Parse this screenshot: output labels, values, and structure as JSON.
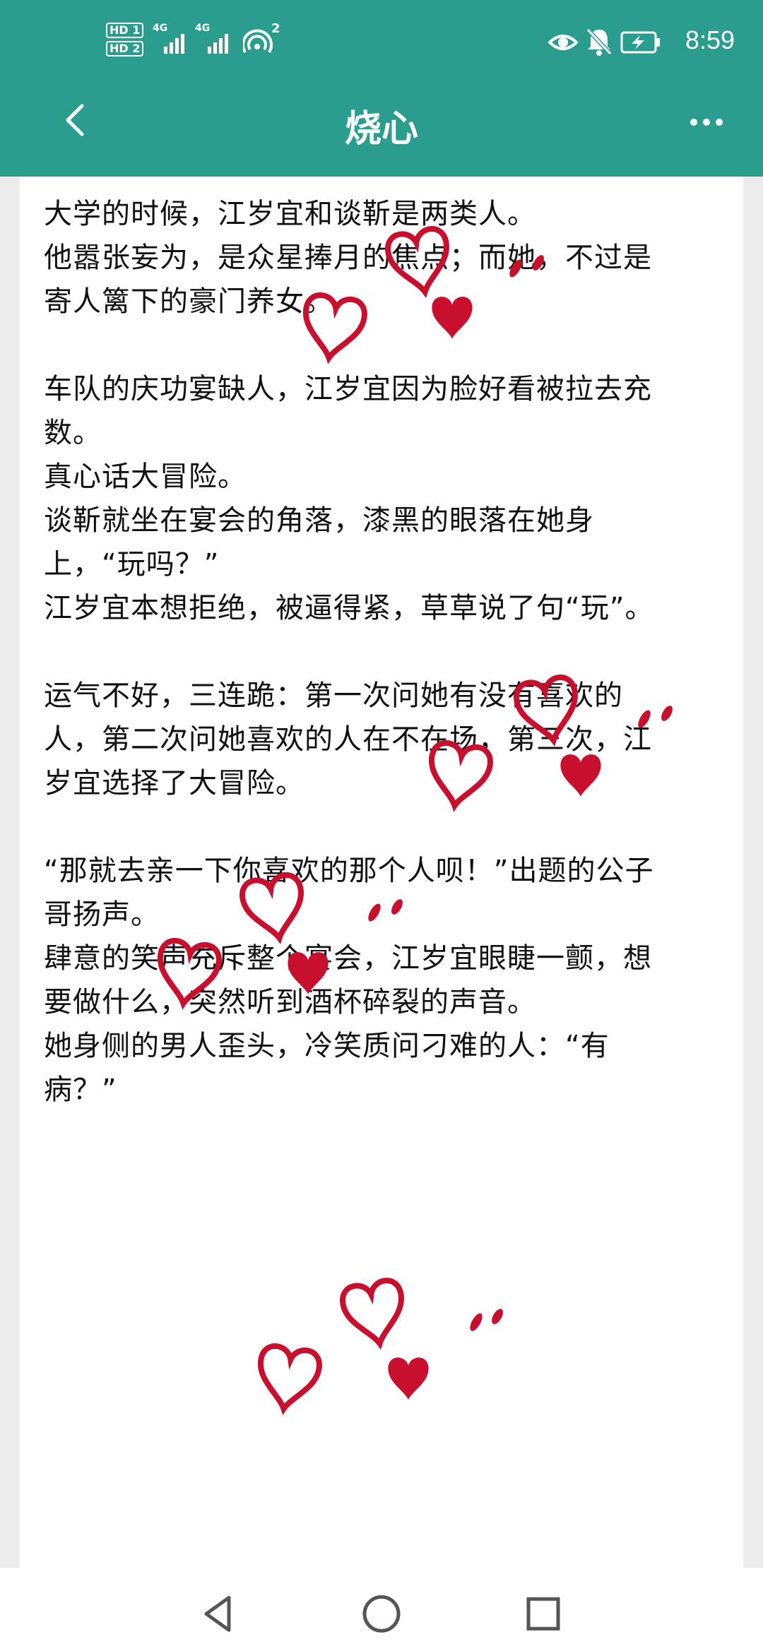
{
  "status_bar": {
    "sim1": "HD 1",
    "sim2": "HD 2",
    "net1": "4G",
    "net2": "4G",
    "hotspot_count": "2",
    "time": "8:59",
    "icons": [
      "eye-icon",
      "mute-icon",
      "battery-charging-icon"
    ]
  },
  "header": {
    "title": "烧心",
    "back_icon": "chevron-left-icon",
    "more_icon": "more-dots-icon"
  },
  "content": {
    "lines": [
      "大学的时候，江岁宜和谈靳是两类人。",
      "他嚣张妄为，是众星捧月的焦点；而她，不过是",
      "寄人篱下的豪门养女。",
      "",
      "车队的庆功宴缺人，江岁宜因为脸好看被拉去充",
      "数。",
      "真心话大冒险。",
      "谈靳就坐在宴会的角落，漆黑的眼落在她身",
      "上，“玩吗？”",
      "江岁宜本想拒绝，被逼得紧，草草说了句“玩”。",
      "",
      "运气不好，三连跪：第一次问她有没有喜欢的",
      "人，第二次问她喜欢的人在不在场，第三次，江",
      "岁宜选择了大冒险。",
      "",
      "“那就去亲一下你喜欢的那个人呗！”出题的公子",
      "哥扬声。",
      "肆意的笑声充斥整个宴会，江岁宜眼睫一颤，想",
      "要做什么，突然听到酒杯碎裂的声音。",
      "她身侧的男人歪头，冷笑质问刁难的人：“有",
      "病？”"
    ]
  },
  "overlay": {
    "decoration": "red hearts",
    "color": "#c8102e"
  },
  "nav": {
    "back_icon": "triangle-back-icon",
    "home_icon": "circle-home-icon",
    "recents_icon": "square-recents-icon"
  },
  "colors": {
    "header_bg": "#2a9d8f",
    "page_bg": "#ececec",
    "text": "#111111"
  }
}
